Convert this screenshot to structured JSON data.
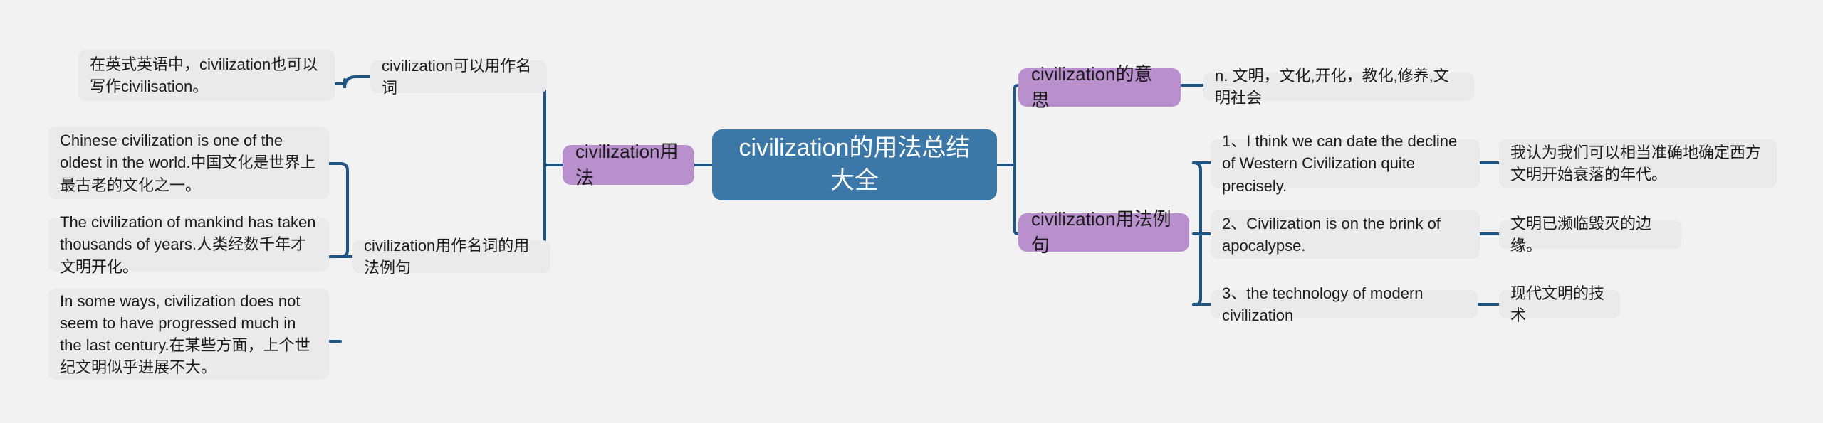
{
  "theme": {
    "background": "#f2f2f2",
    "link_color": "#1f5582",
    "root_fill": "#3b78a8",
    "root_text": "#ffffff",
    "branch_fill": "#b98fce",
    "leaf_fill": "#eaeaea",
    "text_color": "#1a1a1a"
  },
  "root": {
    "label": "civilization的用法总结大全"
  },
  "left": {
    "branch": {
      "label": "civilization用法"
    },
    "children": [
      {
        "label": "civilization可以用作名词",
        "notes": [
          {
            "text": "在英式英语中，civilization也可以写作civilisation。"
          }
        ]
      },
      {
        "label": "civilization用作名词的用法例句",
        "notes": [
          {
            "text": "Chinese civilization is one of the oldest in the world.中国文化是世界上最古老的文化之一。"
          },
          {
            "text": "The civilization of mankind has taken thousands of years.人类经数千年才文明开化。"
          },
          {
            "text": "In some ways, civilization does not seem to have progressed much in the last century.在某些方面，上个世纪文明似乎进展不大。"
          }
        ]
      }
    ]
  },
  "right": {
    "branches": [
      {
        "label": "civilization的意思",
        "children": [
          {
            "text": "n. 文明，文化,开化，教化,修养,文明社会"
          }
        ]
      },
      {
        "label": "civilization用法例句",
        "children": [
          {
            "text": "1、I think we can date the decline of Western Civilization quite precisely.",
            "translation": "我认为我们可以相当准确地确定西方文明开始衰落的年代。"
          },
          {
            "text": "2、Civilization is on the brink of apocalypse.",
            "translation": "文明已濒临毁灭的边缘。"
          },
          {
            "text": "3、the technology of modern civilization",
            "translation": "现代文明的技术"
          }
        ]
      }
    ]
  }
}
